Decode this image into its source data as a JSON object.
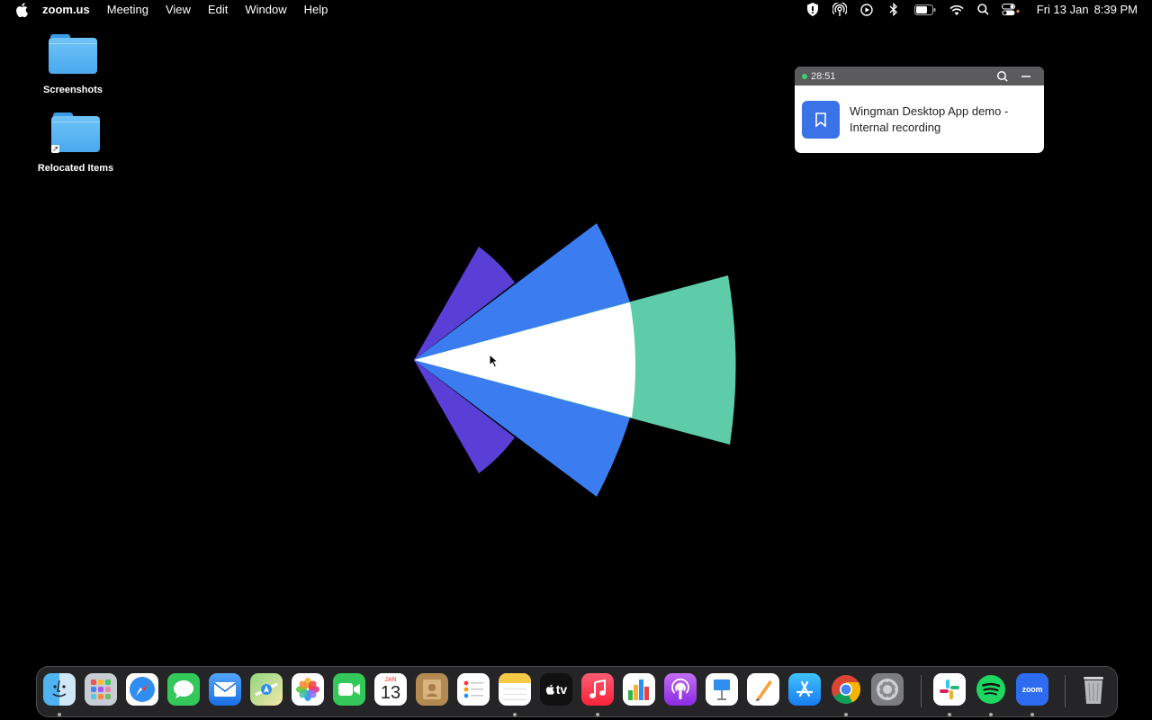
{
  "menubar": {
    "app_name": "zoom.us",
    "menus": [
      "Meeting",
      "View",
      "Edit",
      "Window",
      "Help"
    ],
    "status_icons": [
      "shield-icon",
      "airdrop-icon",
      "play-icon",
      "bluetooth-icon",
      "battery-icon",
      "wifi-icon",
      "search-icon",
      "control-center-icon"
    ],
    "date": "Fri 13 Jan",
    "time": "8:39 PM"
  },
  "desktop": {
    "icons": [
      {
        "label": "Screenshots",
        "icon": "folder-icon"
      },
      {
        "label": "Relocated Items",
        "icon": "folder-alias-icon"
      }
    ]
  },
  "recording_widget": {
    "elapsed": "28:51",
    "title": "Wingman Desktop App demo - Internal recording",
    "accent": "#3a72e8",
    "status_color": "#3ecf6e"
  },
  "logo": {
    "colors": [
      "#5a3fd6",
      "#3b7cf0",
      "#ffffff",
      "#5ecca8"
    ]
  },
  "dock": {
    "apps": [
      {
        "name": "finder",
        "running": true
      },
      {
        "name": "launchpad",
        "running": false
      },
      {
        "name": "safari",
        "running": false
      },
      {
        "name": "messages",
        "running": false
      },
      {
        "name": "mail",
        "running": false
      },
      {
        "name": "maps",
        "running": false
      },
      {
        "name": "photos",
        "running": false
      },
      {
        "name": "facetime",
        "running": false
      },
      {
        "name": "calendar",
        "running": false,
        "month": "JAN",
        "day": "13"
      },
      {
        "name": "contacts",
        "running": false
      },
      {
        "name": "reminders",
        "running": false
      },
      {
        "name": "notes",
        "running": true
      },
      {
        "name": "apple-tv",
        "running": false,
        "label": "tv"
      },
      {
        "name": "music",
        "running": true
      },
      {
        "name": "numbers",
        "running": false
      },
      {
        "name": "podcasts",
        "running": false
      },
      {
        "name": "keynote",
        "running": false
      },
      {
        "name": "pages",
        "running": false
      },
      {
        "name": "app-store",
        "running": false
      },
      {
        "name": "chrome",
        "running": true
      },
      {
        "name": "system-settings",
        "running": false
      },
      {
        "name": "slack",
        "running": true
      },
      {
        "name": "spotify",
        "running": true
      },
      {
        "name": "zoom",
        "running": true,
        "label": "zoom"
      },
      {
        "name": "trash",
        "running": false
      }
    ]
  }
}
